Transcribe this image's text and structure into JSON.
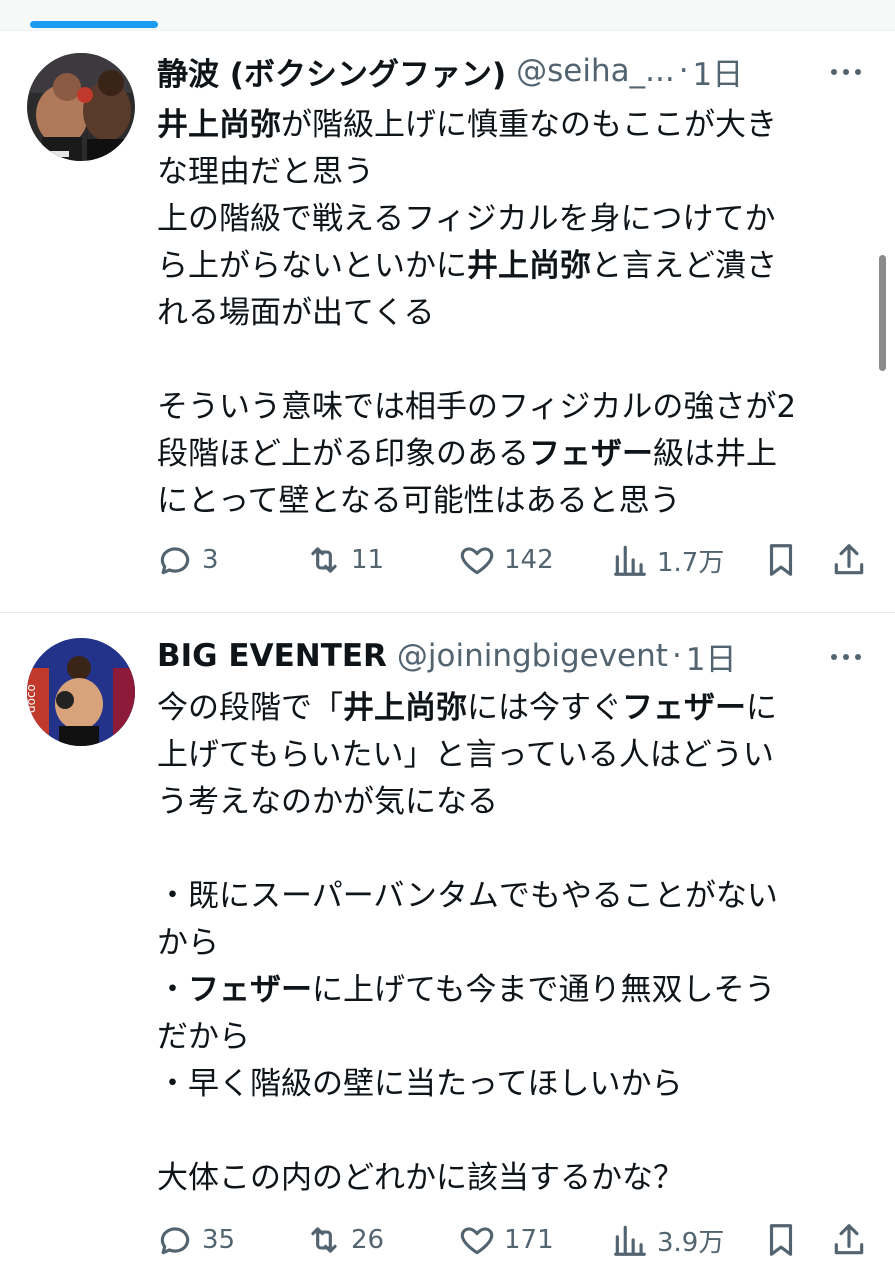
{
  "tweets": [
    {
      "name": "静波 (ボクシングファン)",
      "handle": "@seiha_...",
      "dot": "·",
      "time": "1日",
      "body_lines": [
        [
          {
            "t": "井上尚弥",
            "b": true
          },
          {
            "t": "が階級上げに慎重なのもここが大き"
          }
        ],
        [
          {
            "t": "な理由だと思う"
          }
        ],
        [
          {
            "t": "上の階級で戦えるフィジカルを身につけてか"
          }
        ],
        [
          {
            "t": "ら上がらないといかに"
          },
          {
            "t": "井上尚弥",
            "b": true
          },
          {
            "t": "と言えど潰さ"
          }
        ],
        [
          {
            "t": "れる場面が出てくる"
          }
        ],
        [],
        [
          {
            "t": "そういう意味では相手のフィジカルの強さが2"
          }
        ],
        [
          {
            "t": "段階ほど上がる印象のある"
          },
          {
            "t": "フェザー",
            "b": true
          },
          {
            "t": "級は井上"
          }
        ],
        [
          {
            "t": "にとって壁となる可能性はあると思う"
          }
        ]
      ],
      "replies": "3",
      "retweets": "11",
      "likes": "142",
      "views": "1.7万"
    },
    {
      "name": "BIG EVENTER",
      "handle": "@joiningbigevent",
      "dot": "·",
      "time": "1日",
      "body_lines": [
        [
          {
            "t": "今の段階で「"
          },
          {
            "t": "井上尚弥",
            "b": true
          },
          {
            "t": "には今すぐ"
          },
          {
            "t": "フェザー",
            "b": true
          },
          {
            "t": "に"
          }
        ],
        [
          {
            "t": "上げてもらいたい」と言っている人はどうい"
          }
        ],
        [
          {
            "t": "う考えなのかが気になる"
          }
        ],
        [],
        [
          {
            "t": "・既にスーパーバンタムでもやることがない"
          }
        ],
        [
          {
            "t": "から"
          }
        ],
        [
          {
            "t": "・"
          },
          {
            "t": "フェザー",
            "b": true
          },
          {
            "t": "に上げても今まで通り無双しそう"
          }
        ],
        [
          {
            "t": "だから"
          }
        ],
        [
          {
            "t": "・早く階級の壁に当たってほしいから"
          }
        ],
        [],
        [
          {
            "t": "大体この内のどれかに該当するかな？"
          }
        ]
      ],
      "replies": "35",
      "retweets": "26",
      "likes": "171",
      "views": "3.9万"
    }
  ],
  "icons": [
    "reply-icon",
    "retweet-icon",
    "like-icon",
    "views-icon",
    "bookmark-icon",
    "share-icon",
    "more-icon"
  ],
  "colors": {
    "text": "#0f1419",
    "secondary": "#536471",
    "accent": "#1d9bf0",
    "divider": "#e6eaee"
  }
}
